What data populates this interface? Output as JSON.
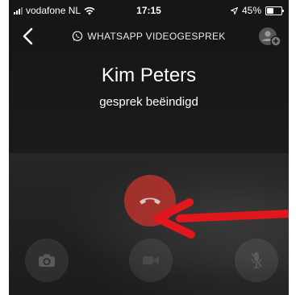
{
  "status_bar": {
    "carrier": "vodafone NL",
    "time": "17:15",
    "battery": "45%",
    "battery_level": 0.45
  },
  "header": {
    "title": "WHATSAPP VIDEOGESPREK",
    "back_icon": "chevron-left-icon",
    "add_participant_icon": "add-person-icon"
  },
  "call": {
    "name": "Kim Peters",
    "status": "gesprek beëindigd"
  },
  "controls": {
    "end_call_icon": "phone-hangup-icon",
    "switch_camera_icon": "switch-camera-icon",
    "video_icon": "video-off-icon",
    "mic_icon": "mic-muted-icon"
  },
  "colors": {
    "end_call": "#b8322c",
    "arrow": "#e0171d",
    "background": "#181818"
  }
}
